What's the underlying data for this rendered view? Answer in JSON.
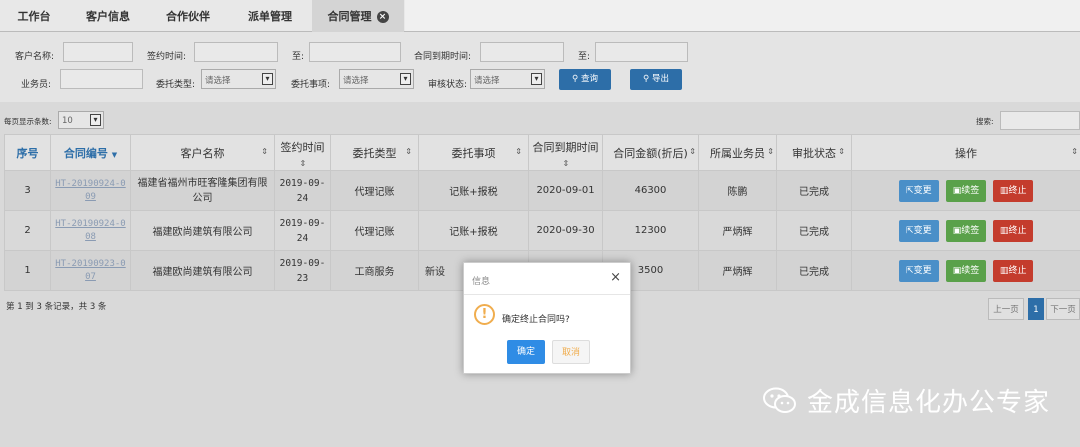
{
  "tabs": [
    {
      "label": "工作台"
    },
    {
      "label": "客户信息"
    },
    {
      "label": "合作伙伴"
    },
    {
      "label": "派单管理"
    },
    {
      "label": "合同管理",
      "close_glyph": "×"
    }
  ],
  "filters": {
    "customer_name_label": "客户名称:",
    "sign_time_label": "签约时间:",
    "to_label_1": "至:",
    "contract_expire_label": "合同到期时间:",
    "to_label_2": "至:",
    "salesman_label": "业务员:",
    "entrust_type_label": "委托类型:",
    "entrust_type_value": "请选择",
    "entrust_item_label": "委托事项:",
    "entrust_item_value": "请选择",
    "audit_status_label": "审核状态:",
    "audit_status_value": "请选择",
    "query_button": "查询",
    "export_button": "导出"
  },
  "options": {
    "page_size_label": "每页显示条数:",
    "page_size_value": "10",
    "search_label": "搜索:"
  },
  "table": {
    "headers": [
      "序号",
      "合同编号",
      "客户名称",
      "签约时间",
      "委托类型",
      "委托事项",
      "合同到期时间",
      "合同金额(折后)",
      "所属业务员",
      "审批状态",
      "操作"
    ],
    "rows": [
      {
        "no": "3",
        "contract_no_a": "HT-20190924-0",
        "contract_no_b": "09",
        "customer": "福建省福州市旺客隆集团有限公司",
        "sign_a": "2019-09-",
        "sign_b": "24",
        "type": "代理记账",
        "item": "记账+报税",
        "expire": "2020-09-01",
        "amount": "46300",
        "salesman": "陈鹏",
        "status": "已完成"
      },
      {
        "no": "2",
        "contract_no_a": "HT-20190924-0",
        "contract_no_b": "08",
        "customer": "福建欧尚建筑有限公司",
        "sign_a": "2019-09-",
        "sign_b": "24",
        "type": "代理记账",
        "item": "记账+报税",
        "expire": "2020-09-30",
        "amount": "12300",
        "salesman": "严炳辉",
        "status": "已完成"
      },
      {
        "no": "1",
        "contract_no_a": "HT-20190923-0",
        "contract_no_b": "07",
        "customer": "福建欧尚建筑有限公司",
        "sign_a": "2019-09-",
        "sign_b": "23",
        "type": "工商服务",
        "item": "新设",
        "expire": "",
        "amount": "3500",
        "salesman": "严炳辉",
        "status": "已完成"
      }
    ],
    "actions": {
      "change": "变更",
      "renew": "续签",
      "terminate": "终止"
    }
  },
  "pager": {
    "info": "第 1 到 3 条记录，共 3 条",
    "prev": "上一页",
    "current": "1",
    "next": "下一页"
  },
  "modal": {
    "title": "信息",
    "close": "×",
    "icon_glyph": "!",
    "message": "确定终止合同吗?",
    "ok": "确定",
    "cancel": "取消"
  },
  "watermark": {
    "text": "金成信息化办公专家"
  },
  "colors": {
    "primary": "#2d6ea8",
    "ok": "#2f8ce5",
    "change": "#4a8fc8",
    "renew": "#5aa14a",
    "terminate": "#c43c2d",
    "warn": "#f0ad4e"
  },
  "icons": {
    "change": "share-icon",
    "renew": "save-icon",
    "terminate": "trash-icon",
    "query": "search-icon",
    "export": "search-icon",
    "modal": "warning-icon",
    "watermark": "wechat-icon"
  }
}
